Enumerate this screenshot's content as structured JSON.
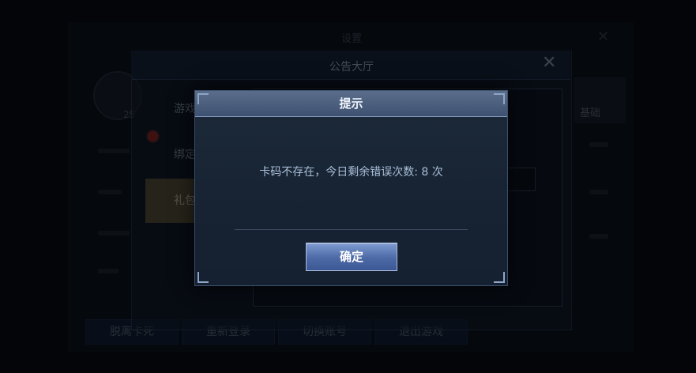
{
  "background": {
    "title": "设置",
    "close_glyph": "✕",
    "level": "25",
    "side_button_label": "基础",
    "bottom_buttons": [
      "脱离卡死",
      "重新登录",
      "切换账号",
      "退出游戏"
    ]
  },
  "announcement_hall": {
    "title": "公告大厅",
    "close_glyph": "✕",
    "tabs": [
      {
        "label": "游戏",
        "active": false
      },
      {
        "label": "绑定",
        "active": false
      },
      {
        "label": "礼包",
        "active": true
      }
    ]
  },
  "dialog": {
    "title": "提示",
    "message": "卡码不存在，今日剩余错误次数: 8 次",
    "confirm_label": "确定"
  },
  "colors": {
    "dialog_header": "#4a5d7e",
    "confirm_button": "#4d69a6",
    "active_tab": "#6b5d3c",
    "notification_dot": "#b0281f"
  }
}
